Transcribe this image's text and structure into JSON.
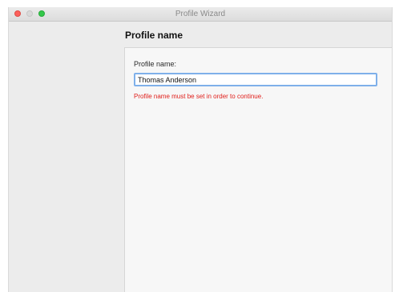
{
  "window": {
    "title": "Profile Wizard"
  },
  "page": {
    "title": "Profile name"
  },
  "form": {
    "label": "Profile name:",
    "value": "Thomas Anderson",
    "error": "Profile name must be set in order to continue."
  },
  "colors": {
    "error": "#e0201c",
    "focus_ring": "#7fb0ea",
    "close": "#fc605c",
    "zoom": "#34c84a"
  }
}
